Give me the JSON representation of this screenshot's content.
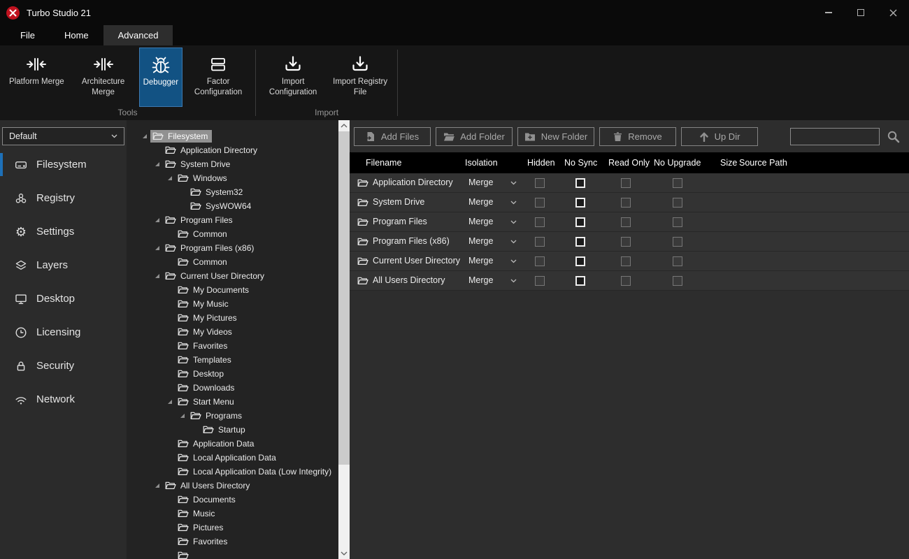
{
  "window": {
    "title": "Turbo Studio 21"
  },
  "menu": {
    "tabs": [
      {
        "label": "File",
        "active": false
      },
      {
        "label": "Home",
        "active": false
      },
      {
        "label": "Advanced",
        "active": true
      }
    ]
  },
  "ribbon": {
    "groups": [
      {
        "label": "Tools",
        "buttons": [
          {
            "label": "Platform Merge",
            "icon": "platform-merge-icon",
            "active": false
          },
          {
            "label": "Architecture Merge",
            "icon": "architecture-merge-icon",
            "active": false
          },
          {
            "label": "Debugger",
            "icon": "debugger-bug-icon",
            "active": true
          },
          {
            "label": "Factor Configuration",
            "icon": "factor-configuration-icon",
            "active": false
          }
        ]
      },
      {
        "label": "Import",
        "buttons": [
          {
            "label": "Import Configuration",
            "icon": "import-icon",
            "active": false
          },
          {
            "label": "Import Registry File",
            "icon": "import-icon",
            "active": false
          }
        ]
      }
    ]
  },
  "sidebar": {
    "profile_selector": {
      "value": "Default"
    },
    "items": [
      {
        "label": "Filesystem",
        "icon": "drive-icon",
        "selected": true
      },
      {
        "label": "Registry",
        "icon": "registry-icon",
        "selected": false
      },
      {
        "label": "Settings",
        "icon": "gear-icon",
        "selected": false
      },
      {
        "label": "Layers",
        "icon": "layers-icon",
        "selected": false
      },
      {
        "label": "Desktop",
        "icon": "monitor-icon",
        "selected": false
      },
      {
        "label": "Licensing",
        "icon": "clock-icon",
        "selected": false
      },
      {
        "label": "Security",
        "icon": "lock-icon",
        "selected": false
      },
      {
        "label": "Network",
        "icon": "wifi-icon",
        "selected": false
      }
    ]
  },
  "tree": {
    "items": [
      {
        "label": "Filesystem",
        "level": 0,
        "expanded": true,
        "selected": true
      },
      {
        "label": "Application Directory",
        "level": 1,
        "expanded": false
      },
      {
        "label": "System Drive",
        "level": 1,
        "expanded": true
      },
      {
        "label": "Windows",
        "level": 2,
        "expanded": true
      },
      {
        "label": "System32",
        "level": 3,
        "expanded": false
      },
      {
        "label": "SysWOW64",
        "level": 3,
        "expanded": false
      },
      {
        "label": "Program Files",
        "level": 1,
        "expanded": true
      },
      {
        "label": "Common",
        "level": 2,
        "expanded": false
      },
      {
        "label": "Program Files (x86)",
        "level": 1,
        "expanded": true
      },
      {
        "label": "Common",
        "level": 2,
        "expanded": false
      },
      {
        "label": "Current User Directory",
        "level": 1,
        "expanded": true
      },
      {
        "label": "My Documents",
        "level": 2,
        "expanded": false
      },
      {
        "label": "My Music",
        "level": 2,
        "expanded": false
      },
      {
        "label": "My Pictures",
        "level": 2,
        "expanded": false
      },
      {
        "label": "My Videos",
        "level": 2,
        "expanded": false
      },
      {
        "label": "Favorites",
        "level": 2,
        "expanded": false
      },
      {
        "label": "Templates",
        "level": 2,
        "expanded": false
      },
      {
        "label": "Desktop",
        "level": 2,
        "expanded": false
      },
      {
        "label": "Downloads",
        "level": 2,
        "expanded": false
      },
      {
        "label": "Start Menu",
        "level": 2,
        "expanded": true
      },
      {
        "label": "Programs",
        "level": 3,
        "expanded": true
      },
      {
        "label": "Startup",
        "level": 4,
        "expanded": false
      },
      {
        "label": "Application Data",
        "level": 2,
        "expanded": false
      },
      {
        "label": "Local Application Data",
        "level": 2,
        "expanded": false
      },
      {
        "label": "Local Application Data (Low Integrity)",
        "level": 2,
        "expanded": false
      },
      {
        "label": "All Users Directory",
        "level": 1,
        "expanded": true
      },
      {
        "label": "Documents",
        "level": 2,
        "expanded": false
      },
      {
        "label": "Music",
        "level": 2,
        "expanded": false
      },
      {
        "label": "Pictures",
        "level": 2,
        "expanded": false
      },
      {
        "label": "Favorites",
        "level": 2,
        "expanded": false
      },
      {
        "label": "",
        "level": 2,
        "expanded": false
      }
    ]
  },
  "toolbar": {
    "buttons": [
      {
        "label": "Add Files",
        "icon": "add-file-icon"
      },
      {
        "label": "Add Folder",
        "icon": "add-folder-icon"
      },
      {
        "label": "New Folder",
        "icon": "new-folder-icon"
      },
      {
        "label": "Remove",
        "icon": "trash-icon"
      },
      {
        "label": "Up Dir",
        "icon": "up-arrow-icon"
      }
    ],
    "search": {
      "value": ""
    }
  },
  "table": {
    "columns": [
      "Filename",
      "Isolation",
      "Hidden",
      "No Sync",
      "Read Only",
      "No Upgrade",
      "Size",
      "Source Path"
    ],
    "rows": [
      {
        "filename": "Application Directory",
        "isolation": "Merge",
        "hidden": false,
        "no_sync": false,
        "read_only": false,
        "no_upgrade": false,
        "size": "",
        "source_path": ""
      },
      {
        "filename": "System Drive",
        "isolation": "Merge",
        "hidden": false,
        "no_sync": false,
        "read_only": false,
        "no_upgrade": false,
        "size": "",
        "source_path": ""
      },
      {
        "filename": "Program Files",
        "isolation": "Merge",
        "hidden": false,
        "no_sync": false,
        "read_only": false,
        "no_upgrade": false,
        "size": "",
        "source_path": ""
      },
      {
        "filename": "Program Files (x86)",
        "isolation": "Merge",
        "hidden": false,
        "no_sync": false,
        "read_only": false,
        "no_upgrade": false,
        "size": "",
        "source_path": ""
      },
      {
        "filename": "Current User Directory",
        "isolation": "Merge",
        "hidden": false,
        "no_sync": false,
        "read_only": false,
        "no_upgrade": false,
        "size": "",
        "source_path": ""
      },
      {
        "filename": "All Users Directory",
        "isolation": "Merge",
        "hidden": false,
        "no_sync": false,
        "read_only": false,
        "no_upgrade": false,
        "size": "",
        "source_path": ""
      }
    ]
  },
  "colors": {
    "accent_blue": "#125283",
    "accent_blue_border": "#3d7ab2",
    "sidebar_accent": "#1d70b8",
    "table_header_bg": "#000000",
    "tree_selected_bg": "#919191",
    "app_icon_red": "#c0121f"
  }
}
